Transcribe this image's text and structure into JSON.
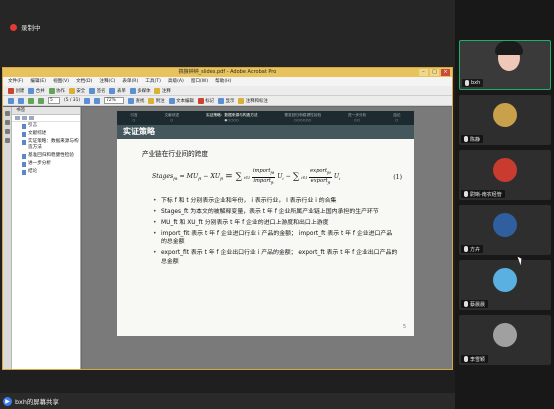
{
  "recording": {
    "label": "录制中"
  },
  "acrobat": {
    "title": "搞狼钟钟_slides.pdf - Adobe Acrobat Pro",
    "menu": [
      "文件(F)",
      "编辑(E)",
      "视图(V)",
      "文档(D)",
      "注释(C)",
      "表单(R)",
      "工具(T)",
      "高级(A)",
      "窗口(W)",
      "帮助(H)"
    ],
    "toolbar1": [
      "创建",
      "合并",
      "协作",
      "安全",
      "签名",
      "表单",
      "多媒体",
      "注释"
    ],
    "page_current": "5",
    "page_total": "(5 / 31)",
    "zoom": "72%",
    "toolbar2": [
      "查找"
    ],
    "toolbar2_right": [
      "附注",
      "文本编辑",
      "标记",
      "显示",
      "注释和标注"
    ],
    "bookmark_panel_title": "书签",
    "bookmarks": [
      "引言",
      "文献综述",
      "实证策略：数据来源与构造方法",
      "基准回归和稳健性检验",
      "进一步分析",
      "结论"
    ]
  },
  "slide": {
    "nav": [
      "引言",
      "文献综述",
      "实证策略：数据来源与构造方法",
      "基准回归和稳健性检验",
      "进一步分析",
      "结论"
    ],
    "nav_active_index": 2,
    "nav_dots": [
      "○",
      "○",
      "●○○○○",
      "○○○○○○",
      "○○",
      "○"
    ],
    "frame_title": "实证策略",
    "heading": "产业链在行业间的跨度",
    "formula": {
      "lhs": "Stages",
      "sub_lhs": "fit",
      "mid": "= MU",
      "minus_xu": "− XU",
      "sum1": "∑",
      "sum_sub": "i∈I",
      "frac1_num": "import",
      "frac1_den": "import",
      "u": "U",
      "frac2_num": "export",
      "frac2_den": "export",
      "eqno": "(1)"
    },
    "bullets": [
      "下标 f 和 t 分别表示企业和年份， i 表示行业， I 表示行业 i 的合集",
      "Stages_ft 为本文的被解释变量，表示 t 年 f 企业所属产业链上国内承担的生产环节",
      "MU_ft 和 XU_ft 分别表示 t 年 f 企业的进口上游度和出口上游度",
      "import_fit 表示 t 年 f 企业进口行业 i 产品的金额； import_ft 表示 t 年 f 企业进口产品的总金额",
      "export_fit 表示 t 年 f 企业出口行业 i 产品的金额； export_ft 表示 t 年 f 企业出口产品的总金额"
    ],
    "page_number": "5"
  },
  "share": {
    "label": "bxh的屏幕共享"
  },
  "participants": [
    {
      "name": "bxh",
      "muted": false,
      "color": "#f0c8b8"
    },
    {
      "name": "陈静",
      "muted": false,
      "color": "#c9a14a"
    },
    {
      "name": "尉晰-南农经管",
      "muted": false,
      "color": "#c93a2f"
    },
    {
      "name": "方卉",
      "muted": false,
      "color": "#2f5f9e"
    },
    {
      "name": "蔡晨晨",
      "muted": false,
      "color": "#5ab0e0"
    },
    {
      "name": "李雪颖",
      "muted": false,
      "color": "#a0a0a0"
    }
  ]
}
